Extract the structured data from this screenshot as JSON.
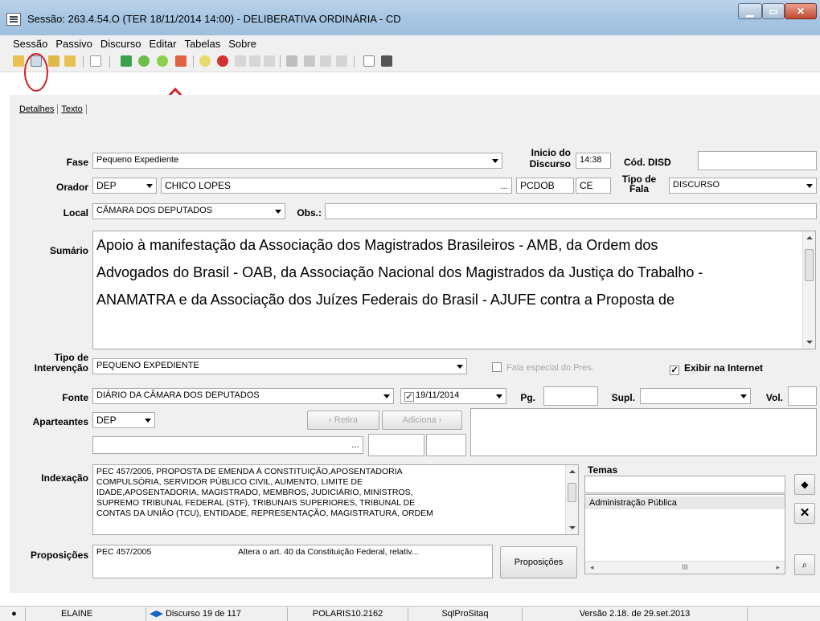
{
  "window": {
    "title": "Sessão: 263.4.54.O (TER 18/11/2014 14:00) - DELIBERATIVA ORDINÁRIA - CD"
  },
  "menu": [
    "Sessão",
    "Passivo",
    "Discurso",
    "Editar",
    "Tabelas",
    "Sobre"
  ],
  "tabs": [
    "Detalhes",
    "Texto"
  ],
  "form": {
    "fase_label": "Fase",
    "fase_value": "Pequeno Expediente",
    "inicio_label_1": "Inicio do",
    "inicio_label_2": "Discurso",
    "inicio_value": "14:38",
    "cod_disd_label": "Cód. DISD",
    "cod_disd_value": "",
    "orador_label": "Orador",
    "orador_tipo": "DEP",
    "orador_nome": "CHICO LOPES",
    "orador_ellipsis": "...",
    "partido": "PCDOB",
    "uf": "CE",
    "tipo_fala_label_1": "Tipo de",
    "tipo_fala_label_2": "Fala",
    "tipo_fala_value": "DISCURSO",
    "local_label": "Local",
    "local_value": "CÂMARA DOS DEPUTADOS",
    "obs_label": "Obs.:",
    "obs_value": "",
    "sumario_label": "Sumário",
    "sumario_lines": [
      "Apoio à manifestação da Associação dos Magistrados Brasileiros - AMB, da Ordem dos",
      "Advogados do Brasil - OAB, da Associação Nacional dos Magistrados da Justiça do Trabalho -",
      "ANAMATRA e da Associação dos Juízes Federais do Brasil - AJUFE contra a Proposta de"
    ],
    "tipo_intervencao_label_1": "Tipo de",
    "tipo_intervencao_label_2": "Intervenção",
    "tipo_intervencao_value": "PEQUENO EXPEDIENTE",
    "fala_especial_label": "Fala especial do Pres.",
    "exibir_internet_label": "Exibir na Internet",
    "exibir_internet_check": "✓",
    "fonte_label": "Fonte",
    "fonte_value": "DIÁRIO DA CÂMARA DOS DEPUTADOS",
    "fonte_date_check": "✓",
    "fonte_date": "19/11/2014",
    "pg_label": "Pg.",
    "pg_value": "",
    "supl_label": "Supl.",
    "supl_value": "",
    "vol_label": "Vol.",
    "vol_value": "",
    "aparteantes_label": "Aparteantes",
    "aparteantes_tipo": "DEP",
    "retira_label": "‹  Retira",
    "adiciona_label": "Adiciona  ›",
    "aparteante_ellipsis": "...",
    "indexacao_label": "Indexação",
    "indexacao_lines": [
      "PEC 457/2005, PROPOSTA DE EMENDA À CONSTITUIÇÃO,APOSENTADORIA",
      "COMPULSÓRIA, SERVIDOR PÚBLICO CIVIL, AUMENTO, LIMITE DE",
      "IDADE,APOSENTADORIA, MAGISTRADO, MEMBROS, JUDICIÁRIO, MINISTROS,",
      "SUPREMO TRIBUNAL FEDERAL (STF), TRIBUNAIS SUPERIORES, TRIBUNAL DE",
      "CONTAS DA UNIÃO (TCU), ENTIDADE, REPRESENTAÇÃO, MAGISTRATURA, ORDEM"
    ],
    "temas_label": "Temas",
    "temas_items": [
      "Administração Pública"
    ],
    "temas_scroll_mid": "III",
    "proposicoes_label": "Proposições",
    "proposicao_numero": "PEC 457/2005",
    "proposicao_ementa": "Altera o art. 40 da Constituição Federal, relativ...",
    "proposicoes_button": "Proposições"
  },
  "statusbar": {
    "user": "ELAINE",
    "discurso": "Discurso 19 de 117",
    "server": "POLARIS10.2162",
    "db": "SqlProSitaq",
    "version": "Versão 2.18. de 29.set.2013"
  },
  "colors": {
    "annotation_red": "#d42020",
    "titlebar": "#a9c7e3",
    "panel": "#f0f0f0"
  }
}
